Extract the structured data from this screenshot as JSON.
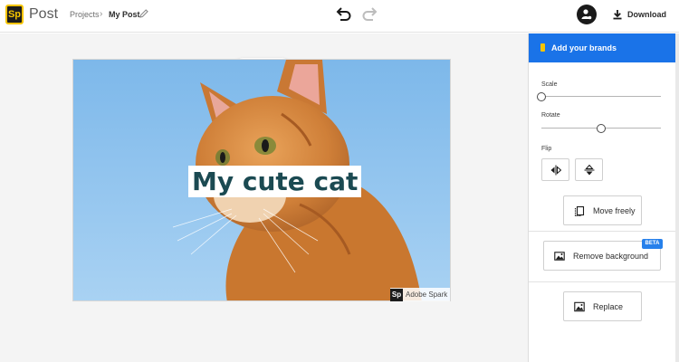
{
  "header": {
    "logo_text": "Sp",
    "app_name": "Post",
    "breadcrumb": {
      "projects": "Projects",
      "separator": "›",
      "current": "My Post"
    },
    "download_label": "Download"
  },
  "canvas": {
    "caption": "My cute cat",
    "watermark": {
      "logo_text": "Sp",
      "text": "Adobe Spark"
    },
    "toolbar_icons": [
      "image-icon",
      "trash-icon"
    ]
  },
  "panel": {
    "brands_label": "Add your brands",
    "scale": {
      "label": "Scale",
      "value": 0.0
    },
    "rotate": {
      "label": "Rotate",
      "value": 0.5
    },
    "flip_label": "Flip",
    "move_freely": "Move freely",
    "remove_background": "Remove background",
    "beta_badge": "BETA",
    "replace": "Replace"
  },
  "colors": {
    "accent_blue": "#1a73e8",
    "brand_yellow": "#f5c400",
    "caption_text": "#1b4a52"
  }
}
